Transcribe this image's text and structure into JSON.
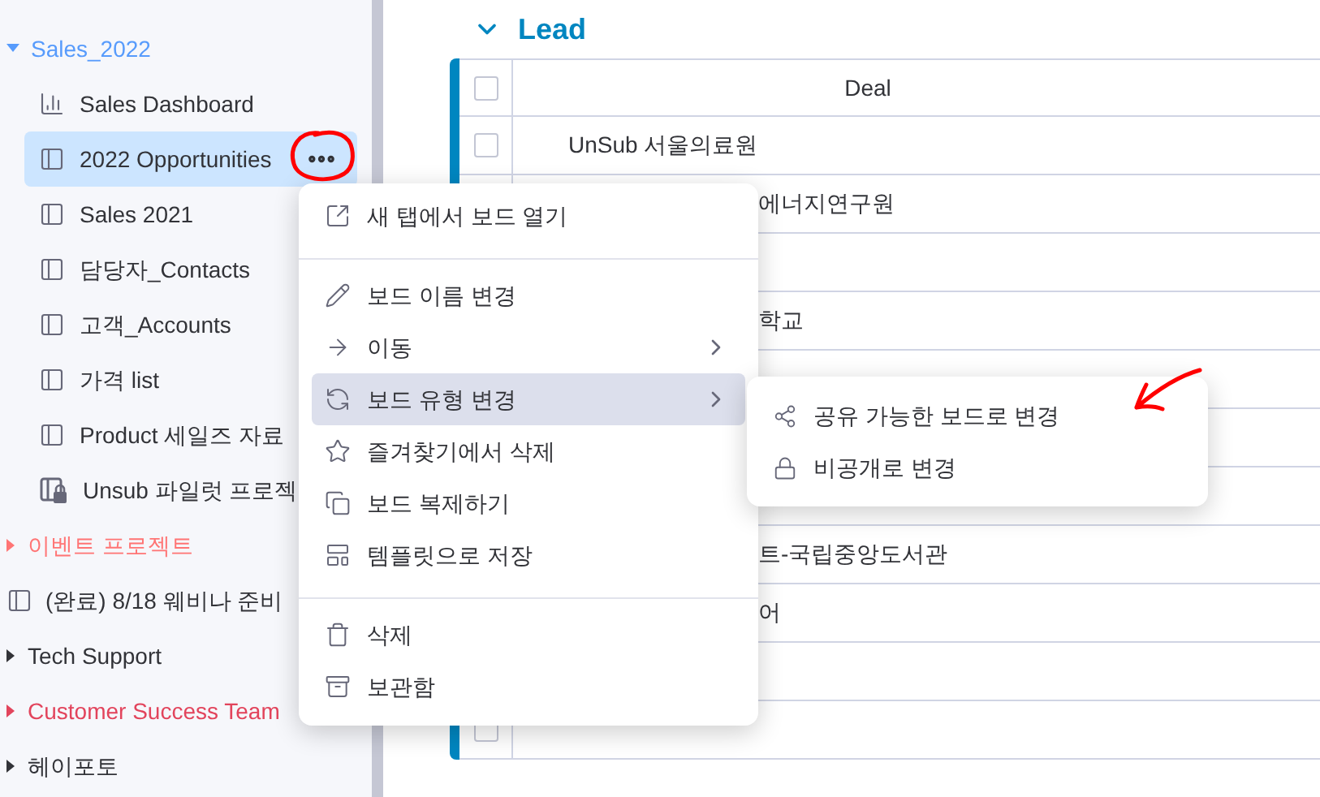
{
  "sidebar": {
    "items": [
      {
        "kind": "folder",
        "label": "Sales_2022",
        "color": "#579bfc",
        "expanded": true,
        "children": [
          {
            "kind": "dashboard",
            "label": "Sales Dashboard",
            "selected": false
          },
          {
            "kind": "board",
            "label": "2022 Opportunities",
            "selected": true
          },
          {
            "kind": "board",
            "label": "Sales 2021",
            "selected": false
          },
          {
            "kind": "board",
            "label": "담당자_Contacts",
            "selected": false
          },
          {
            "kind": "board",
            "label": "고객_Accounts",
            "selected": false
          },
          {
            "kind": "board",
            "label": "가격 list",
            "selected": false
          },
          {
            "kind": "board",
            "label": "Product 세일즈 자료",
            "selected": false
          },
          {
            "kind": "private_board",
            "label": "Unsub 파일럿 프로젝",
            "selected": false
          }
        ]
      },
      {
        "kind": "folder",
        "label": "이벤트 프로젝트",
        "color": "#ff7575",
        "expanded": false
      },
      {
        "kind": "board",
        "label": "(완료) 8/18 웨비나 준비",
        "selected": false
      },
      {
        "kind": "folder",
        "label": "Tech Support",
        "color": "#323338",
        "expanded": false
      },
      {
        "kind": "folder",
        "label": "Customer Success Team",
        "color": "#e2445c",
        "expanded": false
      },
      {
        "kind": "folder",
        "label": "헤이포토",
        "color": "#323338",
        "expanded": false
      }
    ]
  },
  "group": {
    "title": "Lead",
    "color": "#0086c0",
    "expanded": true
  },
  "table": {
    "columns": [
      "Deal"
    ],
    "all_checked": false,
    "rows": [
      {
        "deal": "UnSub 서울의료원",
        "covered": false,
        "checked": false
      },
      {
        "deal": "에너지연구원",
        "covered": true
      },
      {},
      {
        "deal": "학교",
        "covered": true
      },
      {},
      {},
      {},
      {
        "deal": "트-국립중앙도서관",
        "covered": true
      },
      {
        "deal": "어",
        "covered": true
      },
      {},
      {
        "checked": false
      }
    ]
  },
  "context_menu": {
    "sections": [
      [
        {
          "label": "새 탭에서 보드 열기",
          "submenu": false,
          "selected": false
        }
      ],
      [
        {
          "label": "보드 이름 변경",
          "submenu": false,
          "selected": false
        },
        {
          "label": "이동",
          "submenu": true,
          "selected": false
        },
        {
          "label": "보드 유형 변경",
          "submenu": true,
          "selected": true
        },
        {
          "label": "즐겨찾기에서 삭제",
          "submenu": false,
          "selected": false
        },
        {
          "label": "보드 복제하기",
          "submenu": false,
          "selected": false
        },
        {
          "label": "템플릿으로 저장",
          "submenu": false,
          "selected": false
        }
      ],
      [
        {
          "label": "삭제",
          "submenu": false,
          "selected": false
        },
        {
          "label": "보관함",
          "submenu": false,
          "selected": false
        }
      ]
    ]
  },
  "submenu": {
    "items": [
      {
        "label": "공유 가능한 보드로 변경"
      },
      {
        "label": "비공개로 변경"
      }
    ]
  }
}
